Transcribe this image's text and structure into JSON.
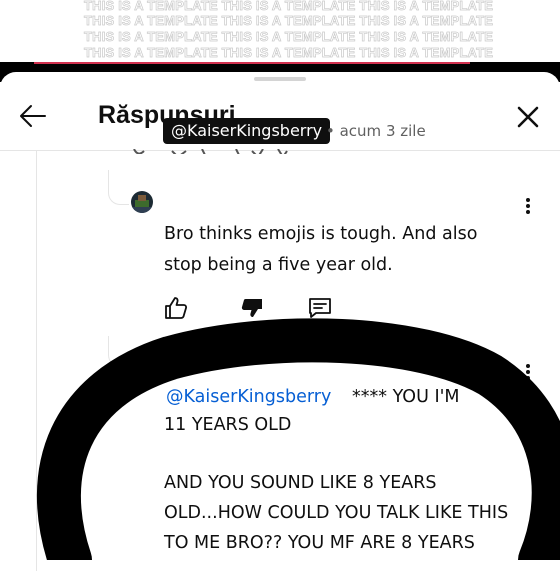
{
  "watermark": {
    "lines": [
      "THIS IS A TEMPLATE THIS IS A TEMPLATE THIS IS A TEMPLATE",
      "THIS IS A TEMPLATE THIS IS A TEMPLATE THIS IS A TEMPLATE",
      "THIS IS A TEMPLATE THIS IS A TEMPLATE THIS IS A TEMPLATE",
      "THIS IS A TEMPLATE THIS IS A TEMPLATE THIS IS A TEMPLATE"
    ]
  },
  "header": {
    "title": "Răspunsuri",
    "back_icon": "arrow-left-icon",
    "close_icon": "close-icon"
  },
  "replies": [
    {
      "handle": "@KaiserKingsberry",
      "time": "• acum 3 zile",
      "lines": [
        "Bro thinks emojis is tough. And also",
        "stop being a five year old."
      ],
      "actions": [
        "thumb-up-icon",
        "thumb-down-icon",
        "reply-icon"
      ]
    },
    {
      "handle": "@KaiserKingsberry",
      "prefix": "**** YOU I'M",
      "lines": [
        "11 YEARS OLD",
        "",
        "AND YOU SOUND LIKE 8 YEARS",
        "OLD...HOW COULD YOU TALK LIKE THIS",
        "TO ME BRO?? YOU MF ARE 8 YEARS"
      ]
    }
  ],
  "colors": {
    "accent_red": "#d0304e",
    "link_blue": "#065fd4",
    "text": "#0f0f0f",
    "muted": "#606060"
  }
}
